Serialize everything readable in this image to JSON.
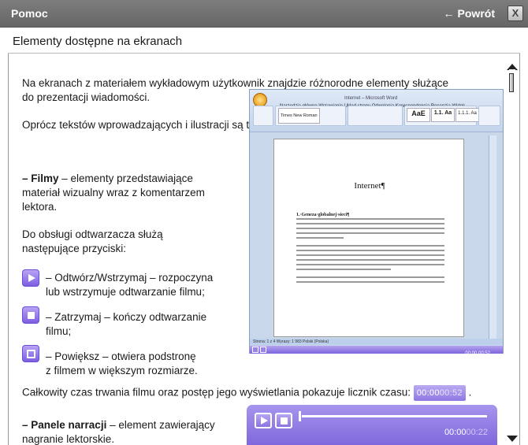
{
  "window": {
    "title": "Pomoc",
    "back_label": "Powrót",
    "back_arrow": "←",
    "close_label": "X"
  },
  "section": {
    "title": "Elementy dostępne na ekranach"
  },
  "content": {
    "intro_line1": "Na ekranach z materiałem wykładowym użytkownik znajdzie różnorodne elementy służące",
    "intro_line2": "do prezentacji wiadomości.",
    "also_line": "Oprócz tekstów wprowadzających i ilustracji są to także:",
    "films_term": "– Filmy",
    "films_desc1": " – elementy przedstawiające",
    "films_desc2": "materiał wizualny wraz z komentarzem",
    "films_desc3": "lektora.",
    "controls_line1": "Do obsługi odtwarzacza służą",
    "controls_line2": "następujące przyciski:",
    "play_desc1": "– Odtwórz/Wstrzymaj – rozpoczyna",
    "play_desc2": "lub wstrzymuje odtwarzanie filmu;",
    "stop_desc1": "– Zatrzymaj – kończy odtwarzanie",
    "stop_desc2": "filmu;",
    "zoom_desc1": "– Powiększ – otwiera podstronę",
    "zoom_desc2": "z filmem w większym rozmiarze.",
    "timer_line": "Całkowity czas trwania filmu oraz postęp jego wyświetlania pokazuje licznik czasu:",
    "timer_current": "00:00",
    "timer_total": "00:52",
    "timer_suffix": ".",
    "panels_term": "– Panele narracji",
    "panels_desc1": " – element zawierający",
    "panels_desc2": "nagranie lektorskie."
  },
  "screenshot": {
    "app_title": "Internet – Microsoft Word",
    "ribbon_tabs": "Narzędzia główne   Wstawianie   Układ strony   Odwołania   Korespondencja   Recenzja   Widok",
    "font_name": "Times New Roman",
    "style1": "AaE",
    "style2": "1.1. Aa",
    "style3": "1.1.1. Aa",
    "doc_title": "Internet¶",
    "doc_heading": "1.·Geneza·globalnej·sieci¶",
    "status_text": "Strona: 1 z 4    Wyrazy: 1 983    Polski (Polska)",
    "player_time": "00:00 00:52"
  },
  "narration_panel": {
    "time_current": "00:00",
    "time_total": "00:22"
  },
  "colors": {
    "accent_purple": "#8f78e3",
    "titlebar_gray": "#6e6e6e"
  }
}
